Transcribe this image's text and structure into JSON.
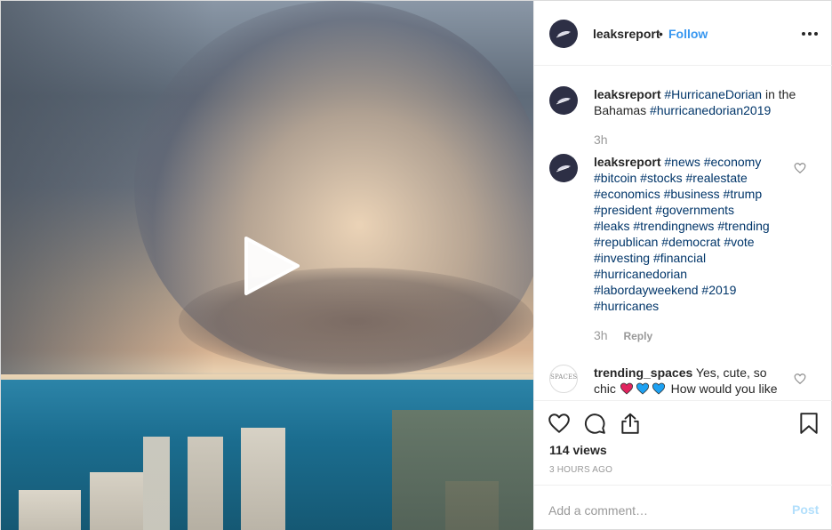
{
  "header": {
    "username": "leaksreport",
    "separator": "•",
    "follow_label": "Follow",
    "more_icon": "more-options-icon"
  },
  "comments": [
    {
      "username": "leaksreport",
      "parts": [
        {
          "type": "tag",
          "text": "#HurricaneDorian"
        },
        {
          "type": "text",
          "text": " in the Bahamas "
        },
        {
          "type": "tag",
          "text": "#hurricanedorian2019"
        }
      ],
      "time": "3h"
    },
    {
      "username": "leaksreport",
      "parts": [
        {
          "type": "tag",
          "text": "#news"
        },
        {
          "type": "text",
          "text": " "
        },
        {
          "type": "tag",
          "text": "#economy"
        },
        {
          "type": "text",
          "text": " "
        },
        {
          "type": "tag",
          "text": "#bitcoin"
        },
        {
          "type": "text",
          "text": " "
        },
        {
          "type": "tag",
          "text": "#stocks"
        },
        {
          "type": "text",
          "text": " "
        },
        {
          "type": "tag",
          "text": "#realestate"
        },
        {
          "type": "text",
          "text": " "
        },
        {
          "type": "tag",
          "text": "#economics"
        },
        {
          "type": "text",
          "text": " "
        },
        {
          "type": "tag",
          "text": "#business"
        },
        {
          "type": "text",
          "text": " "
        },
        {
          "type": "tag",
          "text": "#trump"
        },
        {
          "type": "text",
          "text": " "
        },
        {
          "type": "tag",
          "text": "#president"
        },
        {
          "type": "text",
          "text": " "
        },
        {
          "type": "tag",
          "text": "#governments"
        },
        {
          "type": "text",
          "text": " "
        },
        {
          "type": "tag",
          "text": "#leaks"
        },
        {
          "type": "text",
          "text": " "
        },
        {
          "type": "tag",
          "text": "#trendingnews"
        },
        {
          "type": "text",
          "text": " "
        },
        {
          "type": "tag",
          "text": "#trending"
        },
        {
          "type": "text",
          "text": " "
        },
        {
          "type": "tag",
          "text": "#republican"
        },
        {
          "type": "text",
          "text": " "
        },
        {
          "type": "tag",
          "text": "#democrat"
        },
        {
          "type": "text",
          "text": " "
        },
        {
          "type": "tag",
          "text": "#vote"
        },
        {
          "type": "text",
          "text": " "
        },
        {
          "type": "tag",
          "text": "#investing"
        },
        {
          "type": "text",
          "text": " "
        },
        {
          "type": "tag",
          "text": "#financial"
        },
        {
          "type": "text",
          "text": " "
        },
        {
          "type": "tag",
          "text": "#hurricanedorian"
        },
        {
          "type": "text",
          "text": " "
        },
        {
          "type": "tag",
          "text": "#labordayweekend"
        },
        {
          "type": "text",
          "text": " "
        },
        {
          "type": "tag",
          "text": "#2019"
        },
        {
          "type": "text",
          "text": " "
        },
        {
          "type": "tag",
          "text": "#hurricanes"
        }
      ],
      "time": "3h",
      "reply_label": "Reply"
    },
    {
      "username": "trending_spaces",
      "avatar_text": "SPACES",
      "text_before": " Yes, cute, so chic ",
      "emoji_hearts": [
        "red",
        "blue",
        "blue"
      ],
      "colors": {
        "red": "#e0245e",
        "blue": "#1da1f2"
      },
      "text_after": " How would you like to"
    }
  ],
  "actions": {
    "icons": [
      "heart-icon",
      "comment-icon",
      "share-icon",
      "bookmark-icon"
    ],
    "views": "114 views",
    "time_ago": "3 HOURS AGO"
  },
  "add_comment": {
    "placeholder": "Add a comment…",
    "post_label": "Post"
  },
  "colors": {
    "link": "#3897f0",
    "hashtag": "#003569",
    "muted": "#999999",
    "avatar_bg": "#2d2f45"
  }
}
